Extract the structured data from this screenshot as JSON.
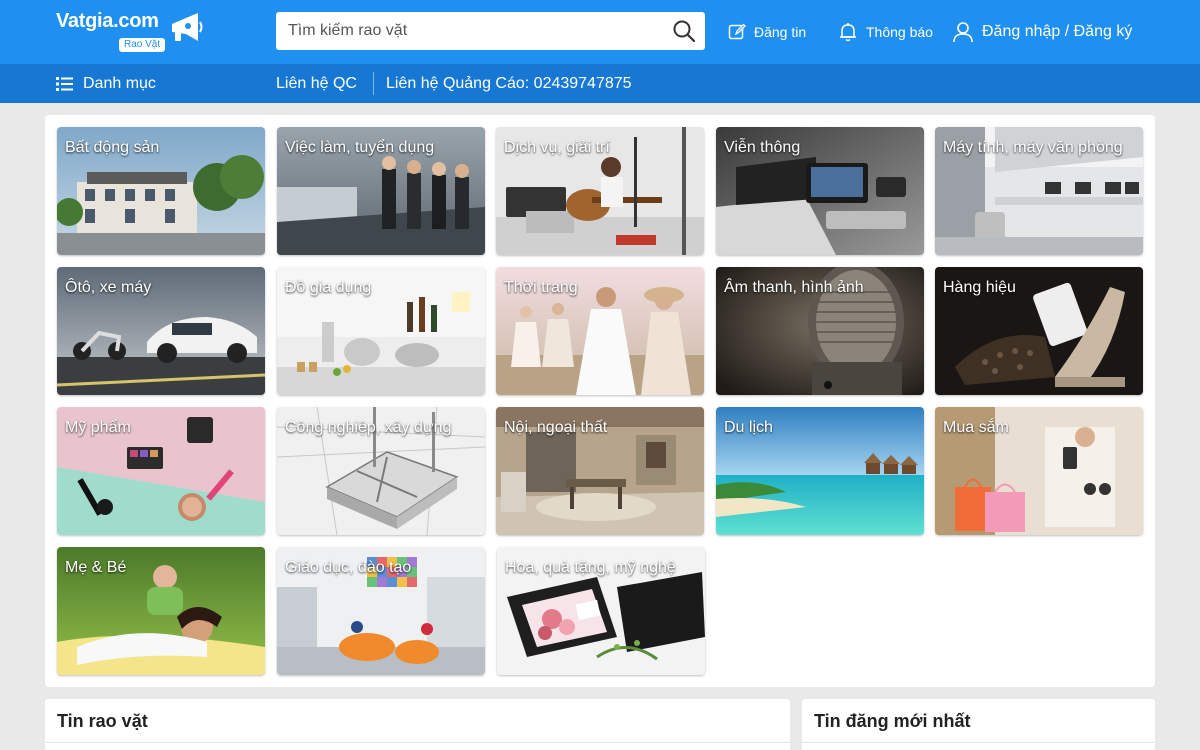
{
  "header": {
    "logo_text": "Vatgia.com",
    "logo_sub": "Rao Vặt",
    "search_placeholder": "Tìm kiếm rao vặt",
    "post_label": "Đăng tin",
    "notify_label": "Thông báo",
    "login_label": "Đăng nhập / Đăng ký"
  },
  "subnav": {
    "menu_label": "Danh mục",
    "contact_label": "Liên hệ QC",
    "phone_label": "Liên hệ Quảng Cáo: 02439747875"
  },
  "categories": [
    {
      "label": "Bất động sản",
      "icon": "real-estate-photo"
    },
    {
      "label": "Việc làm, tuyển dụng",
      "icon": "jobs-photo"
    },
    {
      "label": "Dịch vụ, giải trí",
      "icon": "entertainment-photo"
    },
    {
      "label": "Viễn thông",
      "icon": "telecom-photo"
    },
    {
      "label": "Máy tính, máy văn phòng",
      "icon": "computers-photo"
    },
    {
      "label": "Ôtô, xe máy",
      "icon": "vehicles-photo"
    },
    {
      "label": "Đồ gia dụng",
      "icon": "household-photo"
    },
    {
      "label": "Thời trang",
      "icon": "fashion-photo"
    },
    {
      "label": "Âm thanh, hình ảnh",
      "icon": "audio-video-photo"
    },
    {
      "label": "Hàng hiệu",
      "icon": "luxury-photo"
    },
    {
      "label": "Mỹ phẩm",
      "icon": "cosmetics-photo"
    },
    {
      "label": "Công nghiệp, xây dựng",
      "icon": "construction-photo"
    },
    {
      "label": "Nội, ngoại thất",
      "icon": "interior-photo"
    },
    {
      "label": "Du lịch",
      "icon": "travel-photo"
    },
    {
      "label": "Mua sắm",
      "icon": "shopping-photo"
    },
    {
      "label": "Mẹ & Bé",
      "icon": "mother-baby-photo"
    },
    {
      "label": "Giáo dục, đào tạo",
      "icon": "education-photo"
    },
    {
      "label": "Hoa, quà tặng, mỹ nghệ",
      "icon": "gifts-photo"
    }
  ],
  "sections": {
    "classifieds_title": "Tin rao vặt",
    "latest_title": "Tin đăng mới nhất"
  },
  "colors": {
    "header_bg": "#1f8ff0",
    "subnav_bg": "#1678d3",
    "page_bg": "#e9e9e9"
  }
}
